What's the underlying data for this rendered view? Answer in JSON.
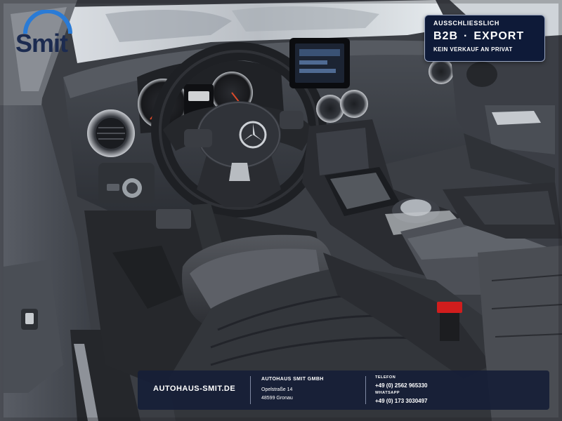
{
  "logo": {
    "text": "Smit"
  },
  "badge": {
    "line1": "AUSSCHLIESSLICH",
    "b2b": "B2B",
    "separator": "·",
    "export": "EXPORT",
    "line3": "KEIN VERKAUF AN PRIVAT"
  },
  "footer": {
    "website": "AUTOHAUS-SMIT.DE",
    "company": "AUTOHAUS SMIT GMBH",
    "street": "Opelstraße 14",
    "city": "48599 Gronau",
    "phone_label": "TELEFON",
    "phone": "+49 (0) 2562 965330",
    "whatsapp_label": "WHATSAPP",
    "whatsapp": "+49 (0) 173 3030497"
  },
  "colors": {
    "brand_navy": "#1c2b50",
    "brand_blue": "#2a7bd6",
    "panel": "#0e1a38"
  }
}
